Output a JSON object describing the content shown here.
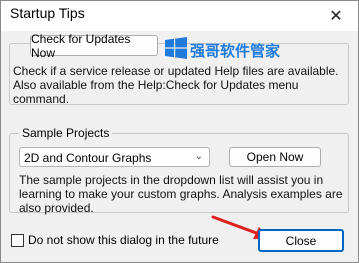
{
  "window": {
    "title": "Startup Tips"
  },
  "updates": {
    "button_label": "Check for Updates Now",
    "description": "Check if a service release or updated Help files are available. Also available from the Help:Check for Updates menu command."
  },
  "watermark": {
    "text": "强哥软件管家"
  },
  "samples": {
    "group_title": "Sample Projects",
    "selected": "2D and Contour Graphs",
    "open_label": "Open Now",
    "description": "The sample projects in the dropdown list will assist you in learning to make your custom graphs. Analysis examples are also provided."
  },
  "footer": {
    "checkbox_label": "Do not show this dialog in the future",
    "checkbox_checked": false,
    "close_label": "Close"
  },
  "colors": {
    "accent": "#0067c0",
    "arrow": "#e02020",
    "watermark": "#1e7bdc"
  }
}
